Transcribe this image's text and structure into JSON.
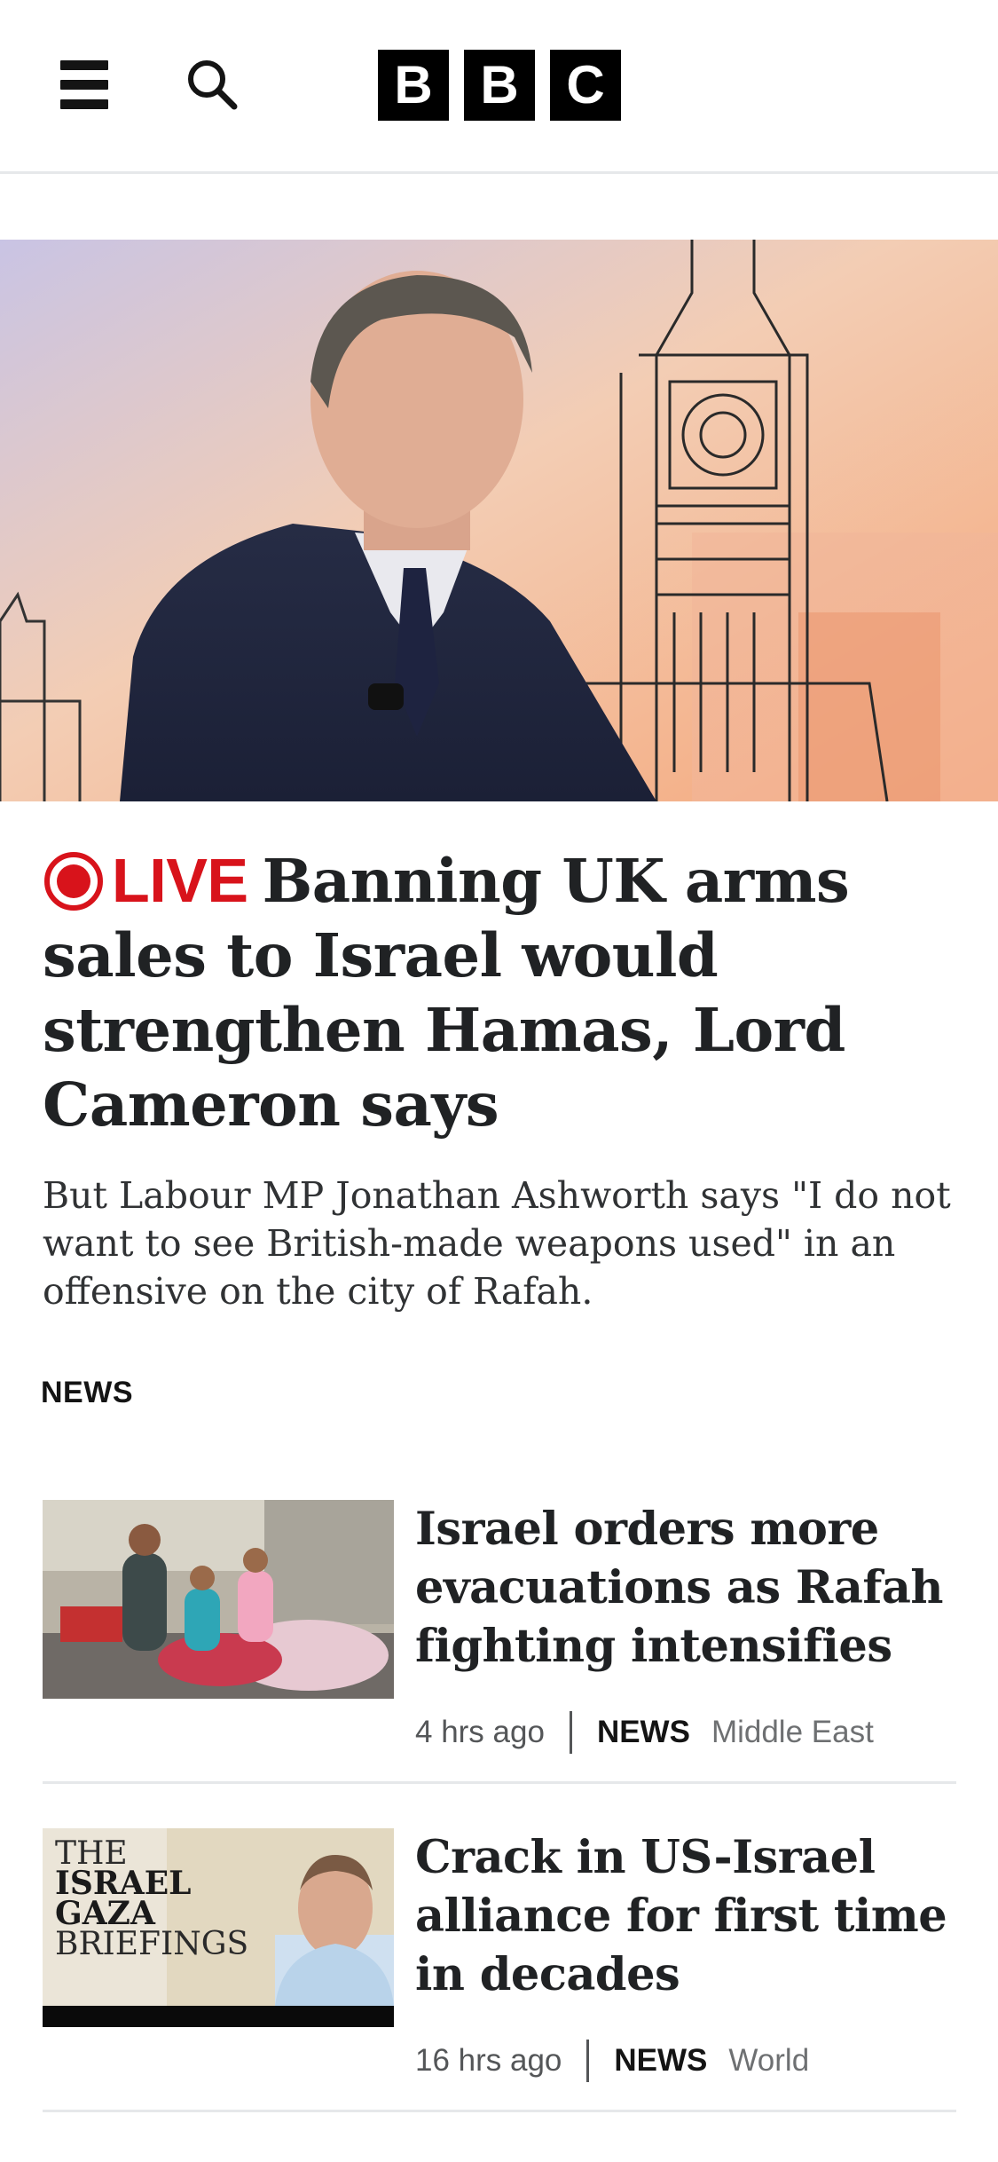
{
  "header": {
    "logo_letters": [
      "B",
      "B",
      "C"
    ],
    "menu_icon": "hamburger-menu-icon",
    "search_icon": "search-icon"
  },
  "hero": {
    "live_label": "LIVE",
    "live_icon": "live-indicator-icon",
    "headline": "Banning UK arms sales to Israel would strengthen Hamas, Lord Cameron says",
    "summary": "But Labour MP Jonathan Ashworth says \"I do not want to see British-made weapons used\" in an offensive on the city of Rafah."
  },
  "section": {
    "label": "NEWS"
  },
  "stories": [
    {
      "title": "Israel orders more evacuations as Rafah fighting intensifies",
      "time": "4 hrs ago",
      "category": "NEWS",
      "subcategory": "Middle East"
    },
    {
      "title": "Crack in US-Israel alliance for first time in decades",
      "time": "16 hrs ago",
      "category": "NEWS",
      "subcategory": "World",
      "thumb_text": [
        "THE",
        "ISRAEL",
        "GAZA",
        "BRIEFINGS"
      ]
    }
  ],
  "colors": {
    "live_red": "#d8131b",
    "text": "#202224",
    "divider": "#e6e8ea"
  }
}
